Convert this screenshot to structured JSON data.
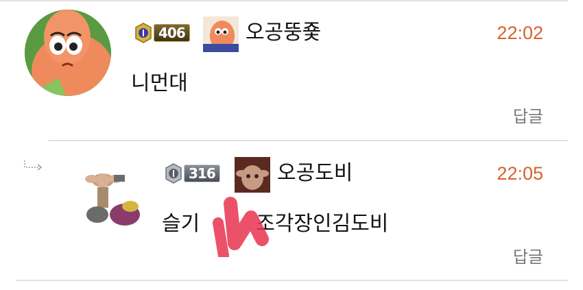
{
  "comments": [
    {
      "level": "406",
      "username": "오공뚱죷",
      "time": "22:02",
      "text": "니먼대",
      "reply_label": "답글"
    },
    {
      "level": "316",
      "username": "오공도비",
      "time": "22:05",
      "text": "슬기",
      "text_after": "조각장인김도비",
      "reply_label": "답글",
      "is_reply": true
    }
  ],
  "colors": {
    "time": "#d8612a",
    "divider": "#e2e2e2",
    "scribble": "#e8344f"
  },
  "icons": [
    "reply-arrow-icon",
    "level-emblem-icon"
  ]
}
